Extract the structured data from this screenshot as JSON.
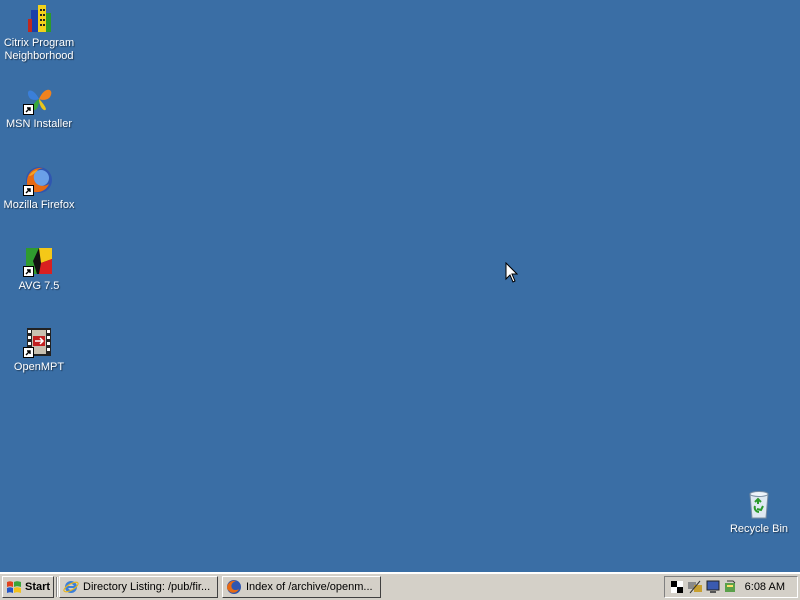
{
  "desktop": {
    "background_color": "#3a6ea5",
    "icons": [
      {
        "label_line1": "Citrix Program",
        "label_line2": "Neighborhood",
        "icon": "citrix-icon"
      },
      {
        "label": "MSN Installer",
        "icon": "msn-butterfly-icon"
      },
      {
        "label": "Mozilla Firefox",
        "icon": "firefox-icon"
      },
      {
        "label": "AVG 7.5",
        "icon": "avg-icon"
      },
      {
        "label": "OpenMPT",
        "icon": "openmpt-icon"
      },
      {
        "label": "Recycle Bin",
        "icon": "recycle-bin-icon"
      }
    ]
  },
  "taskbar": {
    "start_label": "Start",
    "tasks": [
      {
        "label": "Directory Listing: /pub/fir...",
        "icon": "internet-explorer-icon"
      },
      {
        "label": "Index of /archive/openm...",
        "icon": "firefox-icon"
      }
    ],
    "clock": "6:08 AM",
    "tray_icons": [
      "checkerboard-icon",
      "network-icon",
      "monitor-icon",
      "volume-icon"
    ]
  }
}
